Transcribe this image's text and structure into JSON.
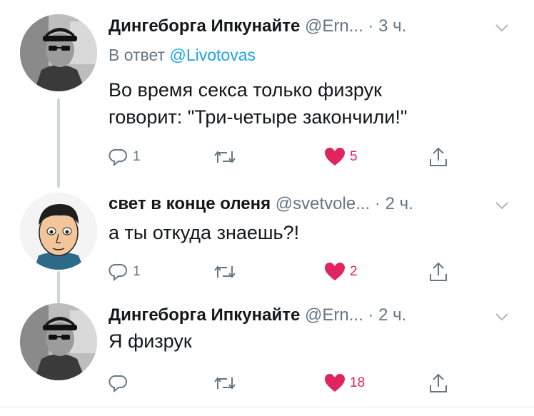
{
  "tweets": [
    {
      "author": "Дингеборга Ипкунайте",
      "handle": "@Ern...",
      "dot": "·",
      "time": "3 ч.",
      "reply_prefix": "В ответ",
      "reply_mention": "@Livotovas",
      "text": "Во время секса только физрук\nговорит: \"Три-четыре закончили!\"",
      "replies": "1",
      "retweets": "",
      "likes": "5",
      "liked": true
    },
    {
      "author": "свет в конце оленя",
      "handle": "@svetvole...",
      "dot": "·",
      "time": "2 ч.",
      "text": "а ты откуда знаешь?!",
      "replies": "1",
      "retweets": "",
      "likes": "2",
      "liked": true
    },
    {
      "author": "Дингеборга Ипкунайте",
      "handle": "@Ern...",
      "dot": "·",
      "time": "2 ч.",
      "text": "Я физрук",
      "replies": "",
      "retweets": "",
      "likes": "18",
      "liked": true
    }
  ],
  "colors": {
    "text": "#14171a",
    "secondary": "#657786",
    "link": "#1da1f2",
    "like": "#e0245e",
    "thread_line": "#ccd6dd"
  },
  "icons": [
    "reply-icon",
    "retweet-icon",
    "heart-icon",
    "share-icon",
    "chevron-down-icon"
  ]
}
